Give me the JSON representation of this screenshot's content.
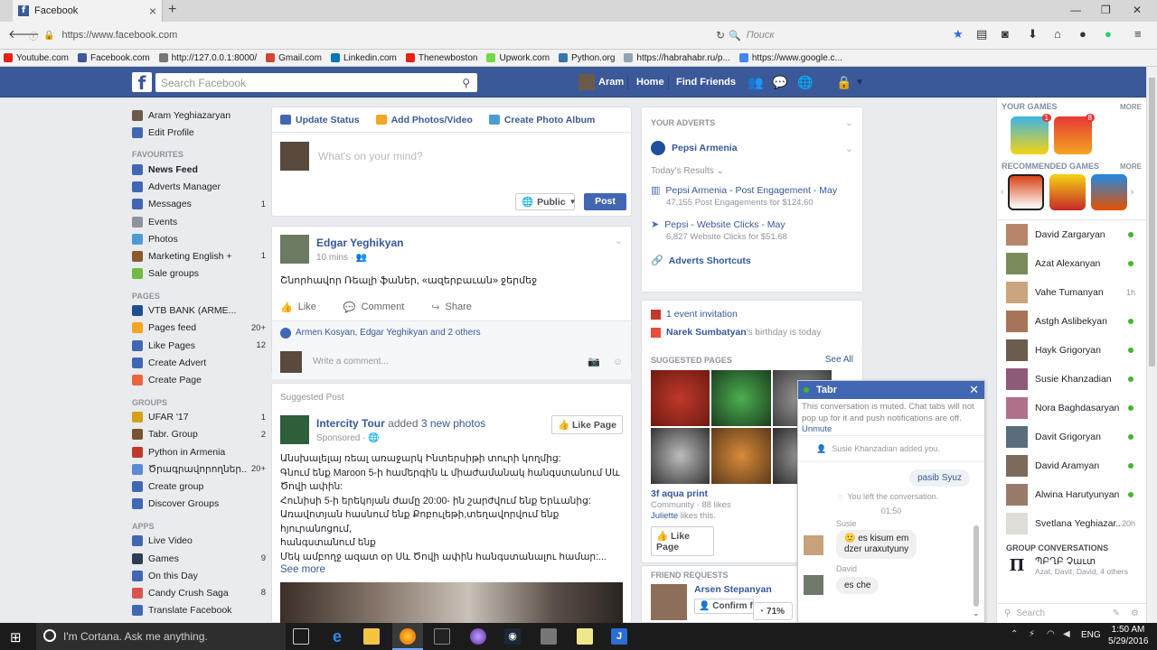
{
  "browser": {
    "tab_title": "Facebook",
    "url": "https://www.facebook.com",
    "search_placeholder": "Поиск",
    "bookmarks": [
      {
        "label": "Youtube.com",
        "color": "#e62117"
      },
      {
        "label": "Facebook.com",
        "color": "#3b5998"
      },
      {
        "label": "http://127.0.0.1:8000/",
        "color": "#777777"
      },
      {
        "label": "Gmail.com",
        "color": "#d44638"
      },
      {
        "label": "Linkedin.com",
        "color": "#0077b5"
      },
      {
        "label": "Thenewboston",
        "color": "#e62117"
      },
      {
        "label": "Upwork.com",
        "color": "#6fda44"
      },
      {
        "label": "Python.org",
        "color": "#3776ab"
      },
      {
        "label": "https://habrahabr.ru/p...",
        "color": "#8fa3b3"
      },
      {
        "label": "https://www.google.c...",
        "color": "#4285f4"
      }
    ]
  },
  "fb_header": {
    "logo": "f",
    "search_placeholder": "Search Facebook",
    "user": "Aram",
    "home": "Home",
    "find_friends": "Find Friends"
  },
  "left": {
    "profile_name": "Aram Yeghiazaryan",
    "edit_profile": "Edit Profile",
    "favourites_head": "FAVOURITES",
    "favourites": [
      {
        "label": "News Feed",
        "count": "",
        "color": "#4267b2"
      },
      {
        "label": "Adverts Manager",
        "count": "",
        "color": "#4267b2"
      },
      {
        "label": "Messages",
        "count": "1",
        "color": "#4267b2"
      },
      {
        "label": "Events",
        "count": "",
        "color": "#8d949e"
      },
      {
        "label": "Photos",
        "count": "",
        "color": "#4b9cd3"
      },
      {
        "label": "Marketing English +",
        "count": "1",
        "color": "#8b5a2b"
      },
      {
        "label": "Sale groups",
        "count": "",
        "color": "#6dbb43"
      }
    ],
    "pages_head": "PAGES",
    "pages": [
      {
        "label": "VTB BANK (ARME...",
        "count": "",
        "color": "#1f4f8f"
      },
      {
        "label": "Pages feed",
        "count": "20+",
        "color": "#f5a623"
      },
      {
        "label": "Like Pages",
        "count": "12",
        "color": "#4267b2"
      },
      {
        "label": "Create Advert",
        "count": "",
        "color": "#4267b2"
      },
      {
        "label": "Create Page",
        "count": "",
        "color": "#e8663d"
      }
    ],
    "groups_head": "GROUPS",
    "groups": [
      {
        "label": "UFAR '17",
        "count": "1",
        "color": "#d4a017"
      },
      {
        "label": "Tabr. Group",
        "count": "2",
        "color": "#7a5230"
      },
      {
        "label": "Python in Armenia",
        "count": "",
        "color": "#c0392b"
      },
      {
        "label": "Ծրագրավորողներ...",
        "count": "20+",
        "color": "#5b8bd0"
      },
      {
        "label": "Create group",
        "count": "",
        "color": "#4267b2"
      },
      {
        "label": "Discover Groups",
        "count": "",
        "color": "#4267b2"
      }
    ],
    "apps_head": "APPS",
    "apps": [
      {
        "label": "Live Video",
        "count": "",
        "color": "#4267b2"
      },
      {
        "label": "Games",
        "count": "9",
        "color": "#2c3e50"
      },
      {
        "label": "On this Day",
        "count": "",
        "color": "#4267b2"
      },
      {
        "label": "Candy Crush Saga",
        "count": "8",
        "color": "#d9534f"
      },
      {
        "label": "Translate Facebook",
        "count": "",
        "color": "#4267b2"
      }
    ]
  },
  "composer": {
    "update_status": "Update Status",
    "add_photos": "Add Photos/Video",
    "create_album": "Create Photo Album",
    "placeholder": "What's on your mind?",
    "privacy": "Public",
    "post": "Post"
  },
  "post1": {
    "author": "Edgar Yeghikyan",
    "time": "10 mins",
    "text": "Շնորհավոր Ռեալի ֆաներ, «ազերբաւան» ջերմեջ",
    "like": "Like",
    "comment": "Comment",
    "share": "Share",
    "likers": "Armen Kosyan, Edgar Yeghikyan and 2 others",
    "write_comment": "Write a comment..."
  },
  "post2": {
    "label": "Suggested Post",
    "author": "Intercity Tour",
    "added": "added",
    "photos": "3 new photos",
    "sponsored": "Sponsored",
    "like_page": "Like Page",
    "lines": [
      "Անսխալելայ ռեալ առաջարկ Ինտերսիթի տուրի կողմից:",
      "Գնում ենք Maroon 5-ի համերգին և միաժամանակ հանգստանում Սև",
      "Ծովի ափին:",
      "Հունիսի 5-ի երեկոյան ժամը 20:00- ին շարժվում ենք Երևանից:",
      "Առավոտյան հասնում ենք Քոբուլեթի,տեղավորվում ենք հյուրանոցում,",
      "հանգստանում ենք",
      "Մեկ ամբողջ ազատ օր Սև Ծովի ափին հանգստանալու համար:..."
    ],
    "see_more": "See more"
  },
  "adverts": {
    "your_adverts": "YOUR ADVERTS",
    "page": "Pepsi Armenia",
    "todays_results": "Today's Results",
    "r1_title": "Pepsi Armenia - Post Engagement - May",
    "r1_sub": "47,155 Post Engagements for $124.60",
    "r2_title": "Pepsi - Website Clicks - May",
    "r2_sub": "6,827 Website Clicks for $51.68",
    "shortcuts": "Adverts Shortcuts"
  },
  "events": {
    "invite": "1 event invitation",
    "bday_name": "Narek Sumbatyan",
    "bday_text": "'s birthday is today"
  },
  "suggested": {
    "head": "SUGGESTED PAGES",
    "see_all": "See All",
    "page_name": "3f aqua print",
    "page_meta": "Community · 88 likes",
    "liker": "Juliette",
    "liker_text": "likes this.",
    "like_page": "Like Page"
  },
  "friend_requests": {
    "head": "FRIEND REQUESTS",
    "name": "Arsen Stepanyan",
    "confirm": "Confirm fr",
    "zoom": "71%"
  },
  "chat": {
    "title": "Tabr",
    "muted_text": "This conversation is muted. Chat tabs will not pop up for it and push notifications are off.",
    "unmute": "Unmute",
    "added_notice": "Susie Khanzadian added you.",
    "msg_out": "pasib Syuz",
    "left_notice": "You left the conversation.",
    "time": "01:50",
    "sender1": "Susie",
    "msg1a": "es kisum em",
    "msg1b": "dzer uraxutyuny",
    "sender2": "David",
    "msg2": "es che"
  },
  "sidebar": {
    "your_games": "YOUR GAMES",
    "more": "MORE",
    "game_badge1": "1",
    "game_badge2": "8",
    "recommended": "RECOMMENDED GAMES",
    "contacts": [
      {
        "name": "David Zargaryan",
        "status": "online",
        "time": ""
      },
      {
        "name": "Azat Alexanyan",
        "status": "online",
        "time": ""
      },
      {
        "name": "Vahe Tumanyan",
        "status": "idle",
        "time": "1h"
      },
      {
        "name": "Astgh Aslibekyan",
        "status": "online",
        "time": ""
      },
      {
        "name": "Hayk Grigoryan",
        "status": "online",
        "time": ""
      },
      {
        "name": "Susie Khanzadian",
        "status": "online",
        "time": ""
      },
      {
        "name": "Nora Baghdasaryan",
        "status": "online",
        "time": ""
      },
      {
        "name": "Davit Grigoryan",
        "status": "online",
        "time": ""
      },
      {
        "name": "David Aramyan",
        "status": "online",
        "time": ""
      },
      {
        "name": "Alwina Harutyunyan",
        "status": "online",
        "time": ""
      },
      {
        "name": "Svetlana Yeghiazar...",
        "status": "idle",
        "time": "20h"
      }
    ],
    "group_conv_head": "GROUP CONVERSATIONS",
    "group_name": "ՊԲՂԲ Չաւտ",
    "group_members": "Azat, Davit, David, 4 others",
    "search_placeholder": "Search"
  },
  "taskbar": {
    "cortana": "I'm Cortana. Ask me anything.",
    "lang": "ENG",
    "time": "1:50 AM",
    "date": "5/29/2016"
  }
}
